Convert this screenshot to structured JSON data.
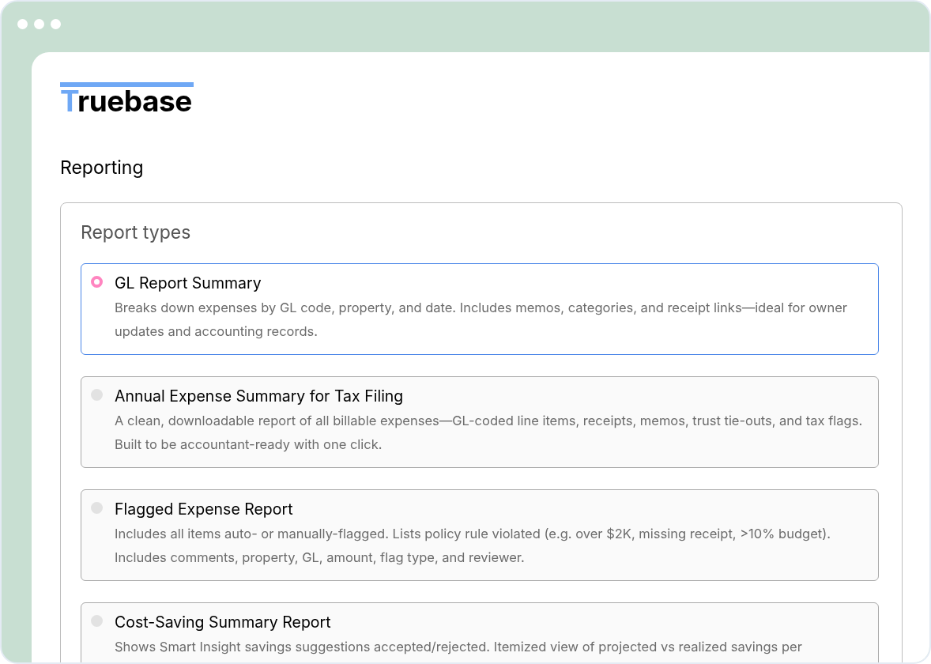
{
  "logo": {
    "text": "Truebase"
  },
  "page_title": "Reporting",
  "report_types": {
    "title": "Report types",
    "items": [
      {
        "title": "GL Report Summary",
        "description": "Breaks down expenses by GL code, property, and date. Includes memos, categories, and receipt links—ideal for owner updates and accounting records.",
        "selected": true
      },
      {
        "title": "Annual Expense Summary for Tax Filing",
        "description": "A clean, downloadable report of all billable expenses—GL-coded line items, receipts, memos, trust tie-outs, and tax flags. Built to be accountant-ready with one click.",
        "selected": false
      },
      {
        "title": "Flagged Expense Report",
        "description": "Includes all items auto- or manually-flagged. Lists policy rule violated (e.g. over $2K, missing receipt, >10% budget). Includes comments, property, GL, amount, flag type, and reviewer.",
        "selected": false
      },
      {
        "title": "Cost-Saving Summary Report",
        "description": "Shows Smart Insight savings suggestions accepted/rejected. Itemized view of projected vs realized savings per",
        "selected": false
      }
    ]
  }
}
